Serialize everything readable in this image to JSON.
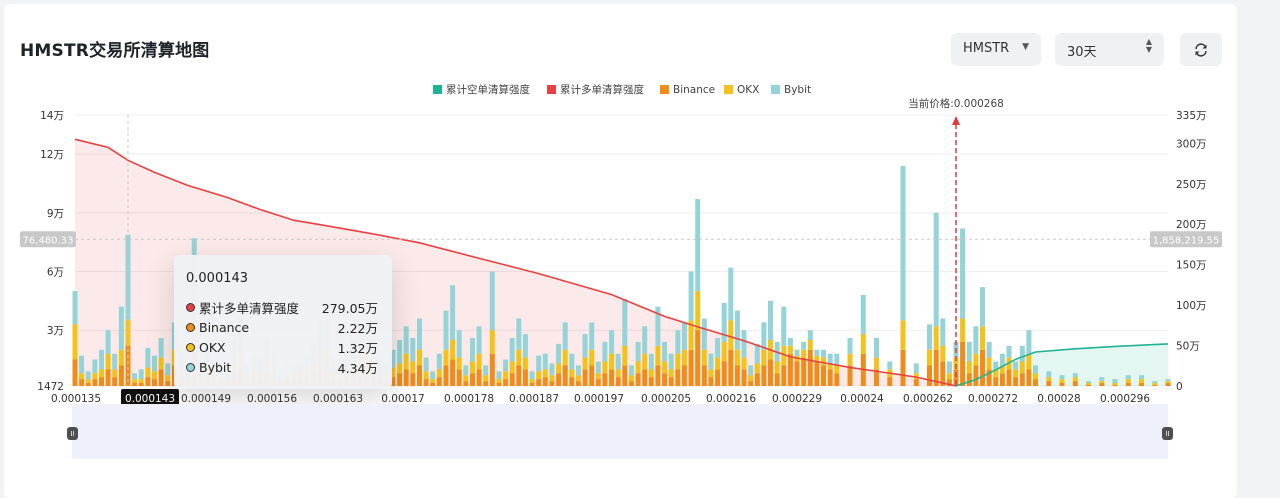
{
  "page": {
    "title": "HMSTR交易所清算地图",
    "symbol_select": "HMSTR",
    "period_select": "30天",
    "refresh_icon": "refresh-icon"
  },
  "chart_data": {
    "type": "bar",
    "legend": [
      {
        "name": "累计空单清算强度",
        "color": "#1fb393"
      },
      {
        "name": "累计多单清算强度",
        "color": "#e84142"
      },
      {
        "name": "Binance",
        "color": "#f08c1a"
      },
      {
        "name": "OKX",
        "color": "#f5c21b"
      },
      {
        "name": "Bybit",
        "color": "#94d3d7"
      }
    ],
    "x_ticks": [
      "0.000135",
      "0.000143",
      "0.000149",
      "0.000156",
      "0.000163",
      "0.00017",
      "0.000178",
      "0.000187",
      "0.000197",
      "0.000205",
      "0.000216",
      "0.000229",
      "0.00024",
      "0.000262",
      "0.000272",
      "0.00028",
      "0.000296"
    ],
    "y_left_ticks": [
      "1472",
      "3万",
      "6万",
      "9万",
      "12万",
      "14万"
    ],
    "y_left_range": [
      1472,
      140000
    ],
    "y_right_ticks": [
      "0",
      "50万",
      "100万",
      "150万",
      "200万",
      "250万",
      "300万",
      "335万"
    ],
    "y_right_range": [
      0,
      3350000
    ],
    "crosshair": {
      "left_value": "76,480.33",
      "right_value": "1,858,219.55",
      "x_value": "0.000143"
    },
    "current_price": {
      "label": "当前价格:0.000268",
      "value": 0.000268
    },
    "cumulative_long": [
      [
        0.000135,
        3050000
      ],
      [
        0.00014,
        2950000
      ],
      [
        0.000143,
        2790500
      ],
      [
        0.000147,
        2640000
      ],
      [
        0.000152,
        2480000
      ],
      [
        0.000158,
        2330000
      ],
      [
        0.000163,
        2180000
      ],
      [
        0.000168,
        2050000
      ],
      [
        0.000173,
        1980000
      ],
      [
        0.00018,
        1880000
      ],
      [
        0.000187,
        1770000
      ],
      [
        0.000195,
        1600000
      ],
      [
        0.000205,
        1390000
      ],
      [
        0.000216,
        1130000
      ],
      [
        0.000224,
        860000
      ],
      [
        0.000229,
        730000
      ],
      [
        0.000236,
        560000
      ],
      [
        0.000243,
        360000
      ],
      [
        0.000252,
        230000
      ],
      [
        0.000262,
        110000
      ],
      [
        0.000268,
        0
      ]
    ],
    "cumulative_short": [
      [
        0.000268,
        0
      ],
      [
        0.000271,
        80000
      ],
      [
        0.000274,
        200000
      ],
      [
        0.000277,
        330000
      ],
      [
        0.00028,
        420000
      ],
      [
        0.000286,
        460000
      ],
      [
        0.000292,
        490000
      ],
      [
        0.0003,
        520000
      ]
    ],
    "tooltip": {
      "price": "0.000143",
      "rows": [
        {
          "label": "累计多单清算强度",
          "value": "279.05万",
          "color": "#e84142"
        },
        {
          "label": "Binance",
          "value": "2.22万",
          "color": "#f08c1a"
        },
        {
          "label": "OKX",
          "value": "1.32万",
          "color": "#f5c21b"
        },
        {
          "label": "Bybit",
          "value": "4.34万",
          "color": "#94d3d7"
        }
      ]
    },
    "bars": [
      [
        0.000135,
        15000,
        18000,
        17000
      ],
      [
        0.000136,
        5000,
        3000,
        9000
      ],
      [
        0.000137,
        3000,
        2000,
        4000
      ],
      [
        0.000138,
        5000,
        3000,
        7000
      ],
      [
        0.000139,
        6000,
        4000,
        10000
      ],
      [
        0.00014,
        10000,
        8000,
        12000
      ],
      [
        0.000141,
        6000,
        4000,
        8000
      ],
      [
        0.000142,
        12000,
        8000,
        22000
      ],
      [
        0.000143,
        22200,
        13200,
        43400
      ],
      [
        0.000144,
        3000,
        2000,
        3000
      ],
      [
        0.000145,
        3000,
        2000,
        5000
      ],
      [
        0.000146,
        6000,
        5000,
        10000
      ],
      [
        0.000147,
        5000,
        4000,
        8000
      ],
      [
        0.000148,
        10000,
        6000,
        10000
      ],
      [
        0.000149,
        4000,
        3000,
        6000
      ],
      [
        0.00015,
        12000,
        8000,
        14000
      ],
      [
        0.000151,
        6000,
        5000,
        8000
      ],
      [
        0.000152,
        3000,
        2000,
        5000
      ],
      [
        0.000153,
        20000,
        15000,
        42000
      ],
      [
        0.000154,
        4000,
        3000,
        7000
      ],
      [
        0.000155,
        8000,
        5000,
        12000
      ],
      [
        0.000156,
        5000,
        3000,
        7000
      ],
      [
        0.000157,
        4000,
        2000,
        6000
      ],
      [
        0.000158,
        3000,
        2000,
        5000
      ],
      [
        0.000159,
        8000,
        6000,
        12000
      ],
      [
        0.00016,
        10000,
        8000,
        20000
      ],
      [
        0.000161,
        4000,
        3000,
        5000
      ],
      [
        0.000162,
        6000,
        4000,
        8000
      ],
      [
        0.000163,
        5000,
        4000,
        7000
      ],
      [
        0.000164,
        8000,
        6000,
        12000
      ],
      [
        0.000165,
        6000,
        4000,
        9000
      ],
      [
        0.000166,
        3000,
        2000,
        5000
      ],
      [
        0.000167,
        5000,
        3000,
        6000
      ],
      [
        0.000168,
        4000,
        3000,
        5000
      ],
      [
        0.000169,
        5000,
        4000,
        5000
      ],
      [
        0.00017,
        6000,
        4000,
        8000
      ],
      [
        0.000171,
        8000,
        5000,
        10000
      ],
      [
        0.000172,
        10000,
        8000,
        17000
      ],
      [
        0.000173,
        12000,
        8000,
        24000
      ],
      [
        0.000174,
        5000,
        4000,
        7000
      ],
      [
        0.000175,
        4000,
        3000,
        8000
      ],
      [
        0.000176,
        6000,
        4000,
        8000
      ],
      [
        0.000177,
        8000,
        6000,
        12000
      ],
      [
        0.000178,
        10000,
        6000,
        14000
      ],
      [
        0.000179,
        12000,
        8000,
        16000
      ],
      [
        0.00018,
        8000,
        6000,
        10000
      ],
      [
        0.000181,
        5000,
        4000,
        6000
      ],
      [
        0.000182,
        4000,
        3000,
        5000
      ],
      [
        0.000183,
        6000,
        5000,
        9000
      ],
      [
        0.000184,
        8000,
        5000,
        12000
      ],
      [
        0.000185,
        10000,
        8000,
        14000
      ],
      [
        0.000186,
        8000,
        6000,
        12000
      ],
      [
        0.000187,
        12000,
        8000,
        16000
      ],
      [
        0.000188,
        5000,
        4000,
        7000
      ],
      [
        0.000189,
        3000,
        2000,
        4000
      ],
      [
        0.00019,
        6000,
        4000,
        8000
      ],
      [
        0.000191,
        12000,
        8000,
        20000
      ],
      [
        0.000192,
        15000,
        10000,
        28000
      ],
      [
        0.000193,
        10000,
        6000,
        14000
      ],
      [
        0.000194,
        4000,
        3000,
        5000
      ],
      [
        0.000195,
        8000,
        6000,
        12000
      ],
      [
        0.000196,
        10000,
        8000,
        14000
      ],
      [
        0.000197,
        4000,
        3000,
        5000
      ],
      [
        0.000198,
        18000,
        12000,
        30000
      ],
      [
        0.000199,
        3000,
        2000,
        4000
      ],
      [
        0.0002,
        5000,
        4000,
        6000
      ],
      [
        0.000201,
        8000,
        6000,
        12000
      ],
      [
        0.000202,
        12000,
        8000,
        16000
      ],
      [
        0.000203,
        10000,
        6000,
        12000
      ],
      [
        0.000204,
        3000,
        2000,
        4000
      ],
      [
        0.000205,
        5000,
        4000,
        8000
      ],
      [
        0.000206,
        6000,
        4000,
        8000
      ],
      [
        0.000207,
        4000,
        3000,
        6000
      ],
      [
        0.000208,
        8000,
        5000,
        10000
      ],
      [
        0.000209,
        12000,
        8000,
        14000
      ],
      [
        0.00021,
        6000,
        4000,
        8000
      ],
      [
        0.000211,
        4000,
        3000,
        5000
      ],
      [
        0.000212,
        10000,
        6000,
        12000
      ],
      [
        0.000213,
        12000,
        8000,
        14000
      ],
      [
        0.000214,
        5000,
        3000,
        6000
      ],
      [
        0.000215,
        8000,
        6000,
        10000
      ],
      [
        0.000216,
        10000,
        8000,
        12000
      ],
      [
        0.000217,
        6000,
        4000,
        8000
      ],
      [
        0.000218,
        12000,
        10000,
        24000
      ],
      [
        0.000219,
        4000,
        3000,
        5000
      ],
      [
        0.00022,
        8000,
        6000,
        10000
      ],
      [
        0.000221,
        10000,
        8000,
        14000
      ],
      [
        0.000222,
        6000,
        4000,
        8000
      ],
      [
        0.000223,
        12000,
        10000,
        20000
      ],
      [
        0.000224,
        8000,
        6000,
        10000
      ],
      [
        0.000225,
        6000,
        4000,
        8000
      ],
      [
        0.000226,
        10000,
        8000,
        12000
      ],
      [
        0.000227,
        12000,
        8000,
        14000
      ],
      [
        0.000228,
        20000,
        15000,
        25000
      ],
      [
        0.000229,
        30000,
        20000,
        47000
      ],
      [
        0.00023,
        12000,
        8000,
        16000
      ],
      [
        0.000231,
        6000,
        4000,
        8000
      ],
      [
        0.000232,
        10000,
        6000,
        10000
      ],
      [
        0.000233,
        14000,
        10000,
        20000
      ],
      [
        0.000234,
        20000,
        15000,
        27000
      ],
      [
        0.000235,
        12000,
        8000,
        20000
      ],
      [
        0.000236,
        10000,
        6000,
        14000
      ],
      [
        0.000237,
        4000,
        3000,
        5000
      ],
      [
        0.000238,
        8000,
        5000,
        10000
      ],
      [
        0.000239,
        12000,
        8000,
        14000
      ],
      [
        0.00024,
        15000,
        10000,
        20000
      ],
      [
        0.000241,
        8000,
        6000,
        10000
      ],
      [
        0.000242,
        12000,
        10000,
        20000
      ],
      [
        0.000243,
        18000,
        4000,
        4000
      ],
      [
        0.000244,
        14000,
        3000,
        3000
      ],
      [
        0.000245,
        16000,
        4000,
        4000
      ],
      [
        0.000246,
        20000,
        5000,
        5000
      ],
      [
        0.000247,
        14000,
        3000,
        3000
      ],
      [
        0.000248,
        12000,
        4000,
        4000
      ],
      [
        0.000249,
        10000,
        3000,
        5000
      ],
      [
        0.00025,
        8000,
        4000,
        6000
      ],
      [
        0.000252,
        12000,
        6000,
        8000
      ],
      [
        0.000254,
        18000,
        10000,
        20000
      ],
      [
        0.000256,
        10000,
        6000,
        10000
      ],
      [
        0.000258,
        6000,
        4000,
        4000
      ],
      [
        0.00026,
        20000,
        15000,
        79000
      ],
      [
        0.000262,
        5000,
        3000,
        5000
      ],
      [
        0.000264,
        12000,
        8000,
        13000
      ],
      [
        0.000265,
        20000,
        12000,
        58000
      ],
      [
        0.000266,
        14000,
        8000,
        14000
      ],
      [
        0.000267,
        5000,
        3000,
        6000
      ],
      [
        0.000268,
        10000,
        6000,
        8000
      ],
      [
        0.000269,
        24000,
        12000,
        46000
      ],
      [
        0.00027,
        8000,
        6000,
        10000
      ],
      [
        0.000271,
        12000,
        6000,
        14000
      ],
      [
        0.000272,
        20000,
        12000,
        20000
      ],
      [
        0.000273,
        10000,
        6000,
        8000
      ],
      [
        0.000274,
        6000,
        4000,
        4000
      ],
      [
        0.000275,
        8000,
        4000,
        6000
      ],
      [
        0.000276,
        10000,
        6000,
        6000
      ],
      [
        0.000277,
        6000,
        4000,
        4000
      ],
      [
        0.000278,
        8000,
        6000,
        8000
      ],
      [
        0.000279,
        10000,
        8000,
        12000
      ],
      [
        0.00028,
        5000,
        3000,
        4000
      ],
      [
        0.000282,
        4000,
        2000,
        3000
      ],
      [
        0.000284,
        3000,
        2000,
        2000
      ],
      [
        0.000286,
        4000,
        2000,
        2000
      ],
      [
        0.000288,
        2000,
        1000,
        1000
      ],
      [
        0.00029,
        3000,
        1000,
        2000
      ],
      [
        0.000292,
        2000,
        1000,
        2000
      ],
      [
        0.000294,
        3000,
        2000,
        2000
      ],
      [
        0.000296,
        3000,
        2000,
        2000
      ],
      [
        0.000298,
        2000,
        1000,
        1000
      ],
      [
        0.0003,
        3000,
        1000,
        1000
      ]
    ]
  }
}
